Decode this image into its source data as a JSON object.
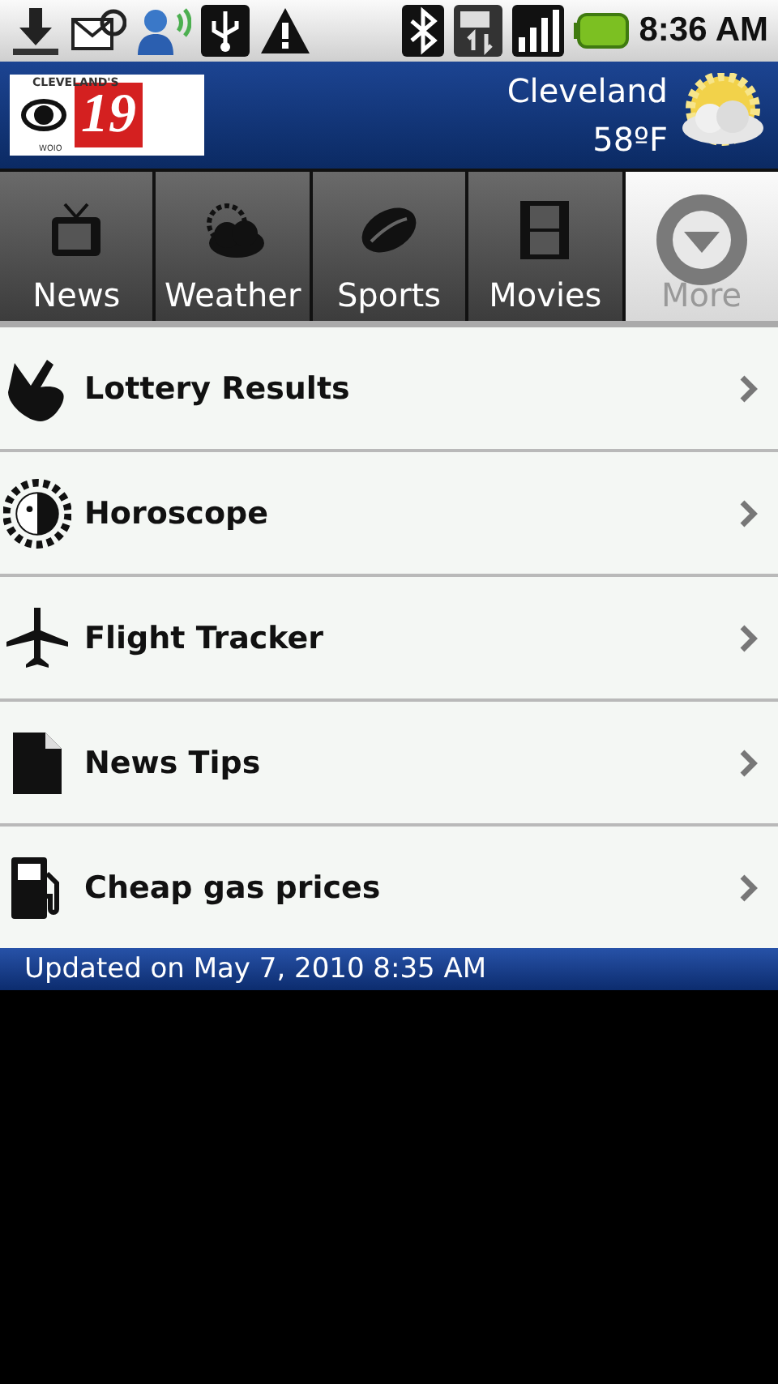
{
  "status_bar": {
    "time": "8:36 AM"
  },
  "header": {
    "logo": {
      "top": "CLEVELAND'S",
      "number": "19",
      "bottom": "WOIO"
    },
    "city": "Cleveland",
    "temperature": "58ºF"
  },
  "tabs": [
    {
      "label": "News",
      "kind": "tv",
      "selected": false
    },
    {
      "label": "Weather",
      "kind": "weather",
      "selected": false
    },
    {
      "label": "Sports",
      "kind": "football",
      "selected": false
    },
    {
      "label": "Movies",
      "kind": "film",
      "selected": false
    },
    {
      "label": "More",
      "kind": "more",
      "selected": true
    }
  ],
  "items": [
    {
      "label": "Lottery Results",
      "kind": "hand"
    },
    {
      "label": "Horoscope",
      "kind": "sun"
    },
    {
      "label": "Flight Tracker",
      "kind": "plane"
    },
    {
      "label": "News Tips",
      "kind": "document"
    },
    {
      "label": "Cheap gas prices",
      "kind": "pump"
    }
  ],
  "footer": "Updated on May 7, 2010 8:35 AM"
}
